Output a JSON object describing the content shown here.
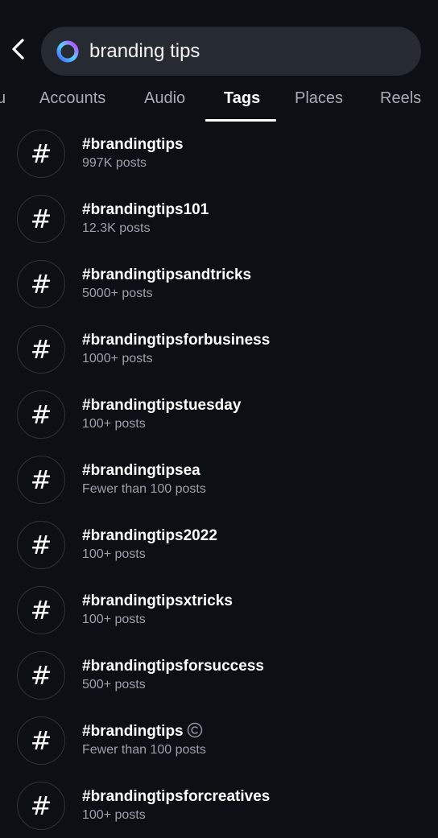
{
  "search": {
    "query": "branding tips"
  },
  "tabs": [
    {
      "label": "u",
      "active": false
    },
    {
      "label": "Accounts",
      "active": false
    },
    {
      "label": "Audio",
      "active": false
    },
    {
      "label": "Tags",
      "active": true
    },
    {
      "label": "Places",
      "active": false
    },
    {
      "label": "Reels",
      "active": false
    }
  ],
  "results": [
    {
      "name": "#brandingtips",
      "count": "997K posts"
    },
    {
      "name": "#brandingtips101",
      "count": "12.3K posts"
    },
    {
      "name": "#brandingtipsandtricks",
      "count": "5000+ posts"
    },
    {
      "name": "#brandingtipsforbusiness",
      "count": "1000+ posts"
    },
    {
      "name": "#brandingtipstuesday",
      "count": "100+ posts"
    },
    {
      "name": "#brandingtipsea",
      "count": "Fewer than 100 posts"
    },
    {
      "name": "#brandingtips2022",
      "count": "100+ posts"
    },
    {
      "name": "#brandingtipsxtricks",
      "count": "100+ posts"
    },
    {
      "name": "#brandingtipsforsuccess",
      "count": "500+ posts"
    },
    {
      "name": "#brandingtips",
      "count": "Fewer than 100 posts",
      "badge": "copyright-icon"
    },
    {
      "name": "#brandingtipsforcreatives",
      "count": "100+ posts"
    }
  ],
  "icons": {
    "hash_glyph": "#",
    "back": "chevron-left-icon",
    "search_logo": "meta-ai-ring-icon"
  },
  "colors": {
    "background": "#0c0f14",
    "search_field": "#262a31",
    "muted_text": "#9ba1aa",
    "accent_ring_start": "#3f66ff",
    "accent_ring_end": "#c33cff"
  }
}
